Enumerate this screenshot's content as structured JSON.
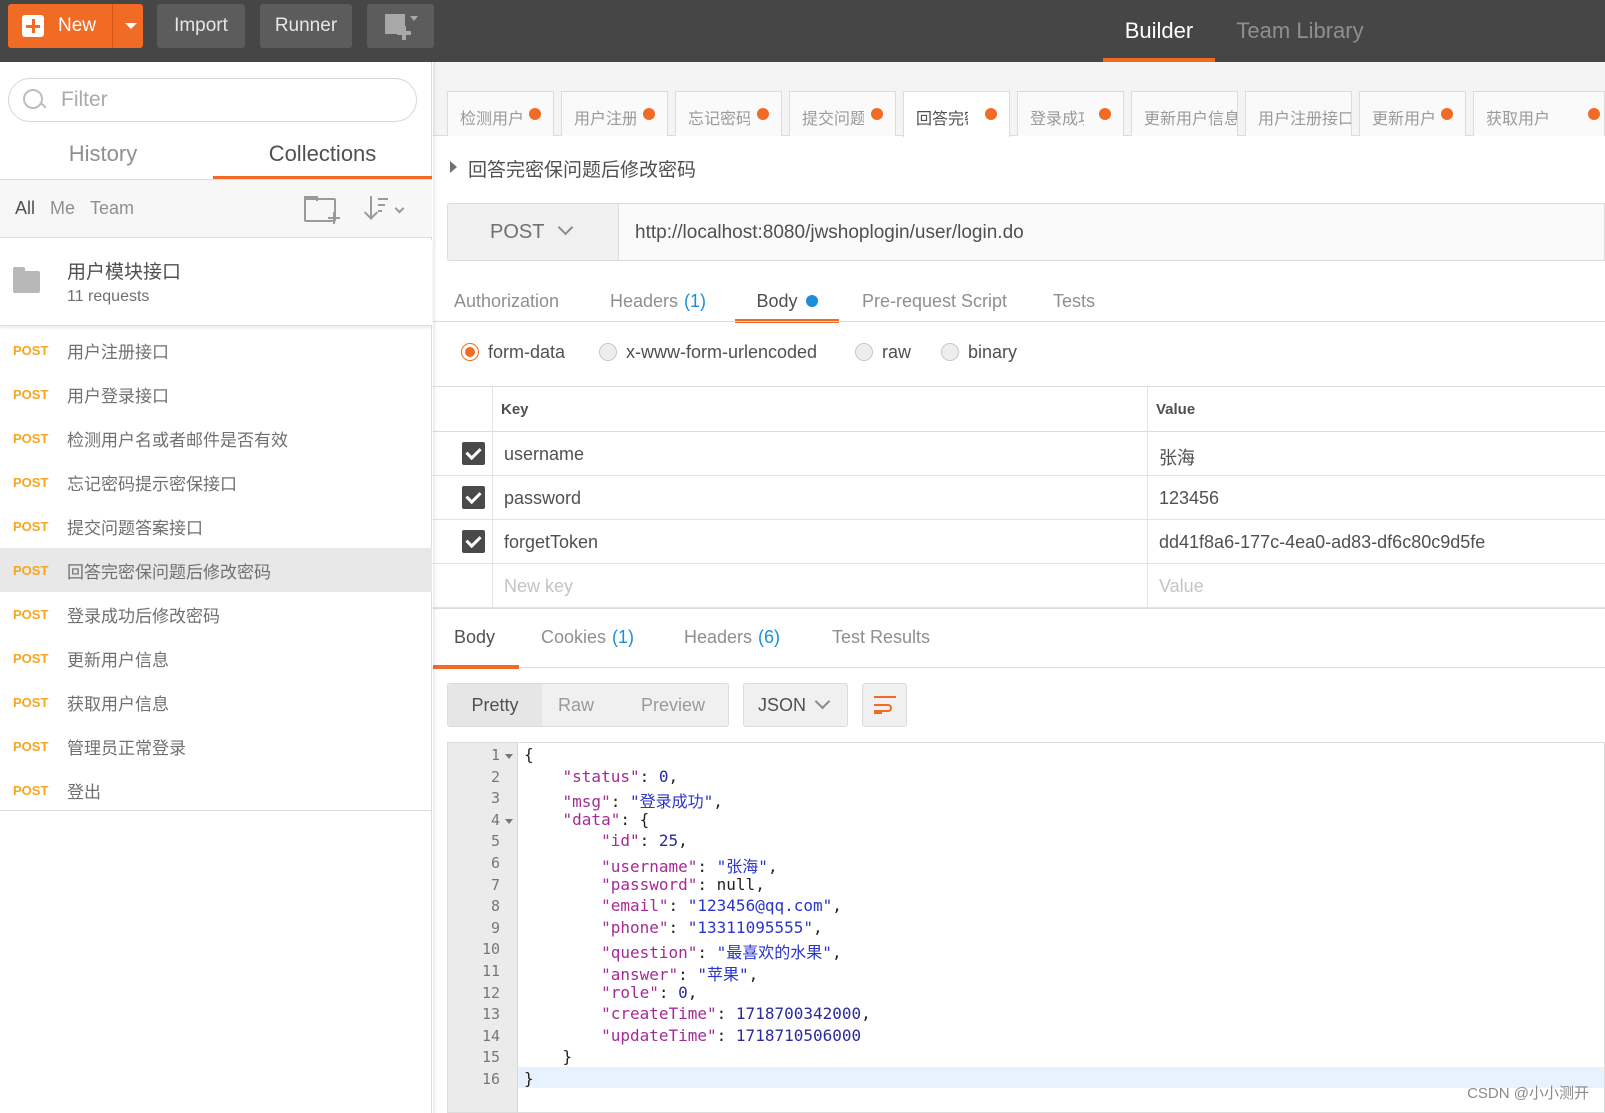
{
  "topbar": {
    "new_label": "New",
    "import_label": "Import",
    "runner_label": "Runner",
    "nav": {
      "builder": "Builder",
      "team_library": "Team Library"
    },
    "accent": "#f26b24"
  },
  "sidebar": {
    "filter_placeholder": "Filter",
    "tabs": {
      "history": "History",
      "collections": "Collections"
    },
    "owner_filters": {
      "all": "All",
      "me": "Me",
      "team": "Team"
    },
    "collection": {
      "name": "用户模块接口",
      "count": "11 requests"
    },
    "requests": [
      {
        "method": "POST",
        "name": "用户注册接口"
      },
      {
        "method": "POST",
        "name": "用户登录接口"
      },
      {
        "method": "POST",
        "name": "检测用户名或者邮件是否有效"
      },
      {
        "method": "POST",
        "name": "忘记密码提示密保接口"
      },
      {
        "method": "POST",
        "name": "提交问题答案接口"
      },
      {
        "method": "POST",
        "name": "回答完密保问题后修改密码"
      },
      {
        "method": "POST",
        "name": "登录成功后修改密码"
      },
      {
        "method": "POST",
        "name": "更新用户信息"
      },
      {
        "method": "POST",
        "name": "获取用户信息"
      },
      {
        "method": "POST",
        "name": "管理员正常登录"
      },
      {
        "method": "POST",
        "name": "登出"
      }
    ]
  },
  "request_tabs": [
    {
      "label": "检测用户"
    },
    {
      "label": "用户注册"
    },
    {
      "label": "忘记密码"
    },
    {
      "label": "提交问题"
    },
    {
      "label": "回答完密"
    },
    {
      "label": "登录成功"
    },
    {
      "label": "更新用户信息"
    },
    {
      "label": "用户注册接口"
    },
    {
      "label": "更新用户"
    },
    {
      "label": "获取用户"
    }
  ],
  "request": {
    "title": "回答完密保问题后修改密码",
    "method": "POST",
    "url": "http://localhost:8080/jwshoplogin/user/login.do",
    "tabs": {
      "authorization": "Authorization",
      "headers": "Headers",
      "headers_count": "(1)",
      "body": "Body",
      "prerequest": "Pre-request Script",
      "tests": "Tests"
    },
    "body_types": {
      "form_data": "form-data",
      "urlencoded": "x-www-form-urlencoded",
      "raw": "raw",
      "binary": "binary"
    },
    "table": {
      "key_header": "Key",
      "value_header": "Value",
      "rows": [
        {
          "key": "username",
          "value": "张海"
        },
        {
          "key": "password",
          "value": "123456"
        },
        {
          "key": "forgetToken",
          "value": "dd41f8a6-177c-4ea0-ad83-df6c80c9d5fe"
        }
      ],
      "new_key_placeholder": "New key",
      "new_value_placeholder": "Value"
    }
  },
  "response": {
    "tabs": {
      "body": "Body",
      "cookies": "Cookies",
      "cookies_count": "(1)",
      "headers": "Headers",
      "headers_count": "(6)",
      "test_results": "Test Results"
    },
    "view_modes": {
      "pretty": "Pretty",
      "raw": "Raw",
      "preview": "Preview"
    },
    "format": "JSON",
    "line_numbers": [
      "1",
      "2",
      "3",
      "4",
      "5",
      "6",
      "7",
      "8",
      "9",
      "10",
      "11",
      "12",
      "13",
      "14",
      "15",
      "16"
    ],
    "lines": [
      {
        "indent": 0,
        "pre": "{",
        "key": "",
        "value": "",
        "vtype": ""
      },
      {
        "indent": 1,
        "pre": "",
        "key": "\"status\"",
        "value": "0",
        "vtype": "num",
        "comma": true
      },
      {
        "indent": 1,
        "pre": "",
        "key": "\"msg\"",
        "value": "\"登录成功\"",
        "vtype": "str",
        "comma": true
      },
      {
        "indent": 1,
        "pre": "",
        "key": "\"data\"",
        "value": "{",
        "vtype": "",
        "comma": false
      },
      {
        "indent": 2,
        "pre": "",
        "key": "\"id\"",
        "value": "25",
        "vtype": "num",
        "comma": true
      },
      {
        "indent": 2,
        "pre": "",
        "key": "\"username\"",
        "value": "\"张海\"",
        "vtype": "str",
        "comma": true
      },
      {
        "indent": 2,
        "pre": "",
        "key": "\"password\"",
        "value": "null",
        "vtype": "",
        "comma": true
      },
      {
        "indent": 2,
        "pre": "",
        "key": "\"email\"",
        "value": "\"123456@qq.com\"",
        "vtype": "str",
        "comma": true
      },
      {
        "indent": 2,
        "pre": "",
        "key": "\"phone\"",
        "value": "\"13311095555\"",
        "vtype": "str",
        "comma": true
      },
      {
        "indent": 2,
        "pre": "",
        "key": "\"question\"",
        "value": "\"最喜欢的水果\"",
        "vtype": "str",
        "comma": true
      },
      {
        "indent": 2,
        "pre": "",
        "key": "\"answer\"",
        "value": "\"苹果\"",
        "vtype": "str",
        "comma": true
      },
      {
        "indent": 2,
        "pre": "",
        "key": "\"role\"",
        "value": "0",
        "vtype": "num",
        "comma": true
      },
      {
        "indent": 2,
        "pre": "",
        "key": "\"createTime\"",
        "value": "1718700342000",
        "vtype": "num",
        "comma": true
      },
      {
        "indent": 2,
        "pre": "",
        "key": "\"updateTime\"",
        "value": "1718710506000",
        "vtype": "num",
        "comma": false
      },
      {
        "indent": 1,
        "pre": "}",
        "key": "",
        "value": "",
        "vtype": ""
      },
      {
        "indent": 0,
        "pre": "}",
        "key": "",
        "value": "",
        "vtype": ""
      }
    ]
  },
  "watermark": "CSDN @小小测开"
}
